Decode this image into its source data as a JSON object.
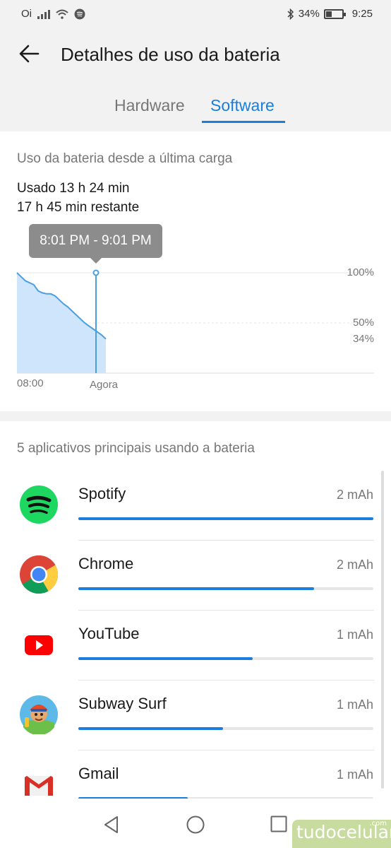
{
  "status_bar": {
    "carrier": "Oi",
    "battery_percent": "34%",
    "time": "9:25",
    "icons": [
      "signal-icon",
      "wifi-icon",
      "spotify-icon",
      "bluetooth-icon",
      "battery-icon"
    ]
  },
  "header": {
    "back_icon": "arrow-left-icon",
    "title": "Detalhes de uso da bateria"
  },
  "tabs": [
    {
      "label": "Hardware",
      "selected": false
    },
    {
      "label": "Software",
      "selected": true
    }
  ],
  "usage": {
    "section_title": "Uso da bateria desde a última carga",
    "used_label": "Usado",
    "used_value": "13 h 24 min",
    "remaining": "17 h 45 min restante",
    "tooltip": "8:01 PM - 9:01 PM",
    "axis": {
      "y_top": "100%",
      "y_mid": "50%",
      "y_current": "34%",
      "x_start": "08:00",
      "x_now": "Agora"
    }
  },
  "chart_data": {
    "type": "area",
    "x_start": "08:00",
    "x_end": "Agora",
    "y": [
      100,
      96,
      92,
      90,
      88,
      82,
      80,
      79,
      79,
      77,
      73,
      69,
      66,
      62,
      58,
      54,
      50,
      47,
      44,
      41,
      38,
      34
    ],
    "ylim": [
      0,
      100
    ],
    "color": "#4a9fe0",
    "grid": true
  },
  "apps": {
    "section_title": "5 aplicativos principais usando a bateria",
    "items": [
      {
        "name": "Spotify",
        "value": "2 mAh",
        "level": 1.0,
        "icon": "spotify-icon"
      },
      {
        "name": "Chrome",
        "value": "2 mAh",
        "level": 0.8,
        "icon": "chrome-icon"
      },
      {
        "name": "YouTube",
        "value": "1 mAh",
        "level": 0.59,
        "icon": "youtube-icon"
      },
      {
        "name": "Subway Surf",
        "value": "1 mAh",
        "level": 0.49,
        "icon": "subway-surf-icon"
      },
      {
        "name": "Gmail",
        "value": "1 mAh",
        "level": 0.37,
        "icon": "gmail-icon"
      }
    ]
  },
  "nav": {
    "icons": [
      "back-triangle-icon",
      "home-circle-icon",
      "recents-square-icon"
    ]
  },
  "watermark": {
    "text": "tudocelular",
    "suffix": ".com"
  },
  "colors": {
    "accent": "#1a7fdc",
    "chart_fill": "#cfe5fb",
    "tooltip": "#8c8c8c"
  }
}
